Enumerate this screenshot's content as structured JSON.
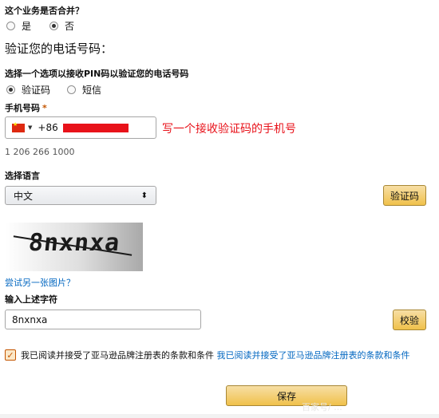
{
  "merge_question": {
    "label": "这个业务是否合并？",
    "options": [
      {
        "label": "是",
        "selected": false
      },
      {
        "label": "否",
        "selected": true
      }
    ]
  },
  "verify": {
    "title": "验证您的电话号码：",
    "method_label": "选择一个选项以接收PIN码以验证您的电话号码",
    "methods": [
      {
        "label": "验证码",
        "selected": true
      },
      {
        "label": "短信",
        "selected": false
      }
    ]
  },
  "phone": {
    "label": "手机号码",
    "required_mark": "*",
    "country_code": "+86",
    "example": "1 206 266 1000",
    "annotation": "写一个接收验证码的手机号"
  },
  "language": {
    "label": "选择语言",
    "selected": "中文",
    "select_arrow": "⬍"
  },
  "verify_code_button": "验证码",
  "captcha": {
    "text": "8nxnxa",
    "retry_link": "尝试另一张图片？"
  },
  "char_input": {
    "label": "输入上述字符",
    "value": "8nxnxa"
  },
  "check_button": "校验",
  "agreement": {
    "checked": true,
    "check_mark": "✓",
    "text": "我已阅读并接受了亚马逊品牌注册表的条款和条件",
    "link": "我已阅读并接受了亚马逊品牌注册表的条款和条件"
  },
  "save_button": "保存",
  "watermark": "百家号/ ...",
  "colors": {
    "primary_button": "#f0c14b",
    "link": "#0066c0",
    "annotation": "#e8121a"
  }
}
